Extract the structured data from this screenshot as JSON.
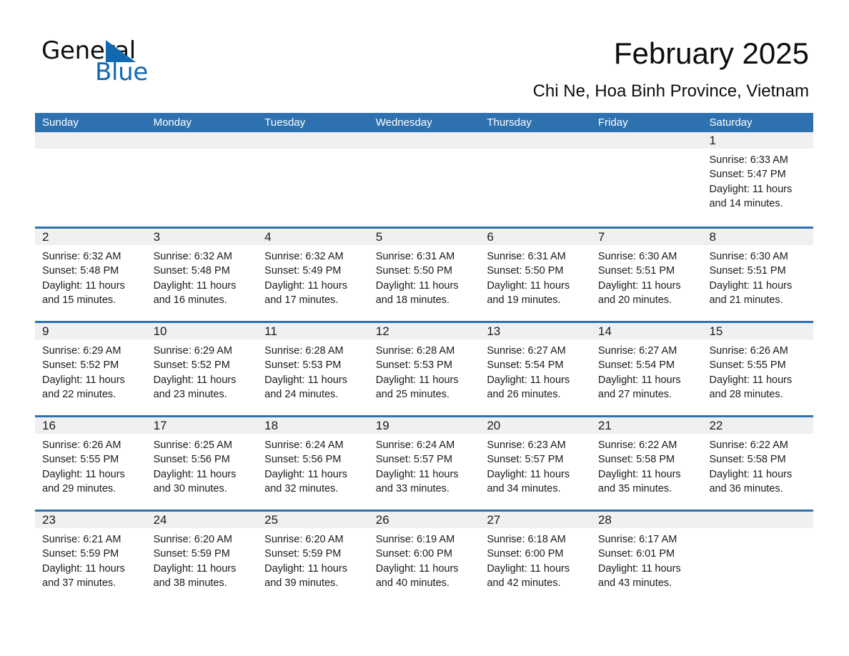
{
  "brand": {
    "name_part1": "General",
    "name_part2": "Blue",
    "triangle_icon": "blue-triangle-logo-mark",
    "accent_color": "#1269b0"
  },
  "header": {
    "title": "February 2025",
    "subtitle": "Chi Ne, Hoa Binh Province, Vietnam"
  },
  "calendar": {
    "header_bg_color": "#2e71b0",
    "band_color": "#f0f0f0",
    "weekdays": [
      "Sunday",
      "Monday",
      "Tuesday",
      "Wednesday",
      "Thursday",
      "Friday",
      "Saturday"
    ],
    "weeks": [
      [
        {
          "day": "",
          "sunrise": "",
          "sunset": "",
          "daylight_line1": "",
          "daylight_line2": ""
        },
        {
          "day": "",
          "sunrise": "",
          "sunset": "",
          "daylight_line1": "",
          "daylight_line2": ""
        },
        {
          "day": "",
          "sunrise": "",
          "sunset": "",
          "daylight_line1": "",
          "daylight_line2": ""
        },
        {
          "day": "",
          "sunrise": "",
          "sunset": "",
          "daylight_line1": "",
          "daylight_line2": ""
        },
        {
          "day": "",
          "sunrise": "",
          "sunset": "",
          "daylight_line1": "",
          "daylight_line2": ""
        },
        {
          "day": "",
          "sunrise": "",
          "sunset": "",
          "daylight_line1": "",
          "daylight_line2": ""
        },
        {
          "day": "1",
          "sunrise": "Sunrise: 6:33 AM",
          "sunset": "Sunset: 5:47 PM",
          "daylight_line1": "Daylight: 11 hours",
          "daylight_line2": "and 14 minutes."
        }
      ],
      [
        {
          "day": "2",
          "sunrise": "Sunrise: 6:32 AM",
          "sunset": "Sunset: 5:48 PM",
          "daylight_line1": "Daylight: 11 hours",
          "daylight_line2": "and 15 minutes."
        },
        {
          "day": "3",
          "sunrise": "Sunrise: 6:32 AM",
          "sunset": "Sunset: 5:48 PM",
          "daylight_line1": "Daylight: 11 hours",
          "daylight_line2": "and 16 minutes."
        },
        {
          "day": "4",
          "sunrise": "Sunrise: 6:32 AM",
          "sunset": "Sunset: 5:49 PM",
          "daylight_line1": "Daylight: 11 hours",
          "daylight_line2": "and 17 minutes."
        },
        {
          "day": "5",
          "sunrise": "Sunrise: 6:31 AM",
          "sunset": "Sunset: 5:50 PM",
          "daylight_line1": "Daylight: 11 hours",
          "daylight_line2": "and 18 minutes."
        },
        {
          "day": "6",
          "sunrise": "Sunrise: 6:31 AM",
          "sunset": "Sunset: 5:50 PM",
          "daylight_line1": "Daylight: 11 hours",
          "daylight_line2": "and 19 minutes."
        },
        {
          "day": "7",
          "sunrise": "Sunrise: 6:30 AM",
          "sunset": "Sunset: 5:51 PM",
          "daylight_line1": "Daylight: 11 hours",
          "daylight_line2": "and 20 minutes."
        },
        {
          "day": "8",
          "sunrise": "Sunrise: 6:30 AM",
          "sunset": "Sunset: 5:51 PM",
          "daylight_line1": "Daylight: 11 hours",
          "daylight_line2": "and 21 minutes."
        }
      ],
      [
        {
          "day": "9",
          "sunrise": "Sunrise: 6:29 AM",
          "sunset": "Sunset: 5:52 PM",
          "daylight_line1": "Daylight: 11 hours",
          "daylight_line2": "and 22 minutes."
        },
        {
          "day": "10",
          "sunrise": "Sunrise: 6:29 AM",
          "sunset": "Sunset: 5:52 PM",
          "daylight_line1": "Daylight: 11 hours",
          "daylight_line2": "and 23 minutes."
        },
        {
          "day": "11",
          "sunrise": "Sunrise: 6:28 AM",
          "sunset": "Sunset: 5:53 PM",
          "daylight_line1": "Daylight: 11 hours",
          "daylight_line2": "and 24 minutes."
        },
        {
          "day": "12",
          "sunrise": "Sunrise: 6:28 AM",
          "sunset": "Sunset: 5:53 PM",
          "daylight_line1": "Daylight: 11 hours",
          "daylight_line2": "and 25 minutes."
        },
        {
          "day": "13",
          "sunrise": "Sunrise: 6:27 AM",
          "sunset": "Sunset: 5:54 PM",
          "daylight_line1": "Daylight: 11 hours",
          "daylight_line2": "and 26 minutes."
        },
        {
          "day": "14",
          "sunrise": "Sunrise: 6:27 AM",
          "sunset": "Sunset: 5:54 PM",
          "daylight_line1": "Daylight: 11 hours",
          "daylight_line2": "and 27 minutes."
        },
        {
          "day": "15",
          "sunrise": "Sunrise: 6:26 AM",
          "sunset": "Sunset: 5:55 PM",
          "daylight_line1": "Daylight: 11 hours",
          "daylight_line2": "and 28 minutes."
        }
      ],
      [
        {
          "day": "16",
          "sunrise": "Sunrise: 6:26 AM",
          "sunset": "Sunset: 5:55 PM",
          "daylight_line1": "Daylight: 11 hours",
          "daylight_line2": "and 29 minutes."
        },
        {
          "day": "17",
          "sunrise": "Sunrise: 6:25 AM",
          "sunset": "Sunset: 5:56 PM",
          "daylight_line1": "Daylight: 11 hours",
          "daylight_line2": "and 30 minutes."
        },
        {
          "day": "18",
          "sunrise": "Sunrise: 6:24 AM",
          "sunset": "Sunset: 5:56 PM",
          "daylight_line1": "Daylight: 11 hours",
          "daylight_line2": "and 32 minutes."
        },
        {
          "day": "19",
          "sunrise": "Sunrise: 6:24 AM",
          "sunset": "Sunset: 5:57 PM",
          "daylight_line1": "Daylight: 11 hours",
          "daylight_line2": "and 33 minutes."
        },
        {
          "day": "20",
          "sunrise": "Sunrise: 6:23 AM",
          "sunset": "Sunset: 5:57 PM",
          "daylight_line1": "Daylight: 11 hours",
          "daylight_line2": "and 34 minutes."
        },
        {
          "day": "21",
          "sunrise": "Sunrise: 6:22 AM",
          "sunset": "Sunset: 5:58 PM",
          "daylight_line1": "Daylight: 11 hours",
          "daylight_line2": "and 35 minutes."
        },
        {
          "day": "22",
          "sunrise": "Sunrise: 6:22 AM",
          "sunset": "Sunset: 5:58 PM",
          "daylight_line1": "Daylight: 11 hours",
          "daylight_line2": "and 36 minutes."
        }
      ],
      [
        {
          "day": "23",
          "sunrise": "Sunrise: 6:21 AM",
          "sunset": "Sunset: 5:59 PM",
          "daylight_line1": "Daylight: 11 hours",
          "daylight_line2": "and 37 minutes."
        },
        {
          "day": "24",
          "sunrise": "Sunrise: 6:20 AM",
          "sunset": "Sunset: 5:59 PM",
          "daylight_line1": "Daylight: 11 hours",
          "daylight_line2": "and 38 minutes."
        },
        {
          "day": "25",
          "sunrise": "Sunrise: 6:20 AM",
          "sunset": "Sunset: 5:59 PM",
          "daylight_line1": "Daylight: 11 hours",
          "daylight_line2": "and 39 minutes."
        },
        {
          "day": "26",
          "sunrise": "Sunrise: 6:19 AM",
          "sunset": "Sunset: 6:00 PM",
          "daylight_line1": "Daylight: 11 hours",
          "daylight_line2": "and 40 minutes."
        },
        {
          "day": "27",
          "sunrise": "Sunrise: 6:18 AM",
          "sunset": "Sunset: 6:00 PM",
          "daylight_line1": "Daylight: 11 hours",
          "daylight_line2": "and 42 minutes."
        },
        {
          "day": "28",
          "sunrise": "Sunrise: 6:17 AM",
          "sunset": "Sunset: 6:01 PM",
          "daylight_line1": "Daylight: 11 hours",
          "daylight_line2": "and 43 minutes."
        },
        {
          "day": "",
          "sunrise": "",
          "sunset": "",
          "daylight_line1": "",
          "daylight_line2": ""
        }
      ]
    ]
  }
}
